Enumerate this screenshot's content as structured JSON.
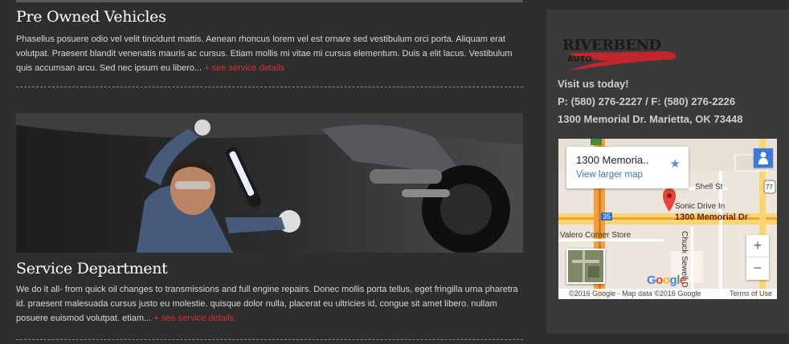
{
  "sections": [
    {
      "title": "Pre Owned Vehicles",
      "body": "Phasellus posuere odio vel velit tincidunt mattis. Aenean rhoncus lorem vel est ornare sed vestibulum orci porta. Aliquam erat volutpat. Praesent blandit venenatis mauris ac cursus. Etiam mollis mi vitae mi cursus elementum. Duis a elit lacus. Vestibulum quis accumsan arcu. Sed nec ipsum eu libero...",
      "more": "+ see service details"
    },
    {
      "title": "Service Department",
      "body": "We do it all- from quick oil changes to transmissions and full engine repairs. Donec mollis porta tellus, eget fringilla urna pharetra id. praesent malesuada cursus justo eu molestie. quisque dolor nulla, placerat eu ultricies id, congue sit amet libero. nullam posuere euismod volutpat. etiam...",
      "more": "+ see service details"
    }
  ],
  "sidebar": {
    "logo_top": "RIVERBEND",
    "logo_bottom": "AUTO",
    "visit": "Visit us today!",
    "phone": "P: (580) 276-2227  /  F: (580) 276-2226",
    "address": "1300 Memorial Dr. Marietta, OK  73448"
  },
  "map": {
    "card_title": "1300 Memoria..",
    "card_link": "View larger map",
    "labels": {
      "shell": "Shell St",
      "sonic": "Sonic Drive In",
      "memorial": "1300 Memorial Dr",
      "valero": "Valero Corner Store",
      "chuck": "Chuck Sewell D",
      "i35": "35",
      "us77": "77"
    },
    "google": "Google",
    "copyright": "©2016 Google - Map data ©2016 Google",
    "terms": "Terms of Use",
    "zoom_in": "+",
    "zoom_out": "−"
  },
  "colors": {
    "accent": "#d2322d",
    "link": "#3b76c4",
    "background": "#2e2e2e",
    "sidebar": "#3a3a3a"
  }
}
